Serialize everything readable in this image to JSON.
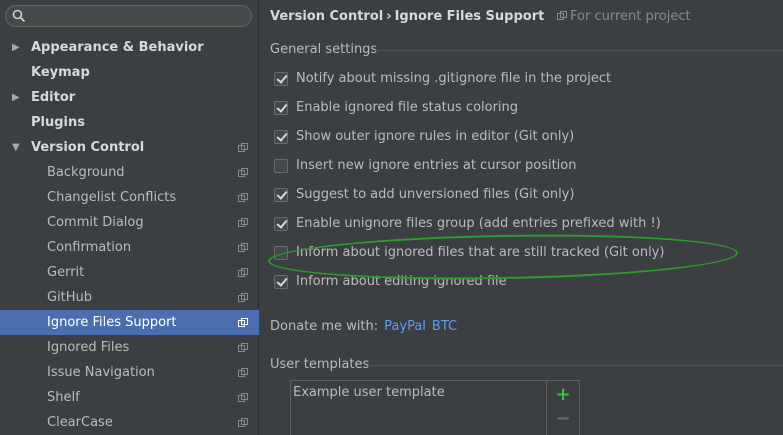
{
  "search": {
    "placeholder": ""
  },
  "sidebar": {
    "items": [
      {
        "label": "Appearance & Behavior",
        "level": 0,
        "expandable": true,
        "expanded": false
      },
      {
        "label": "Keymap",
        "level": 0,
        "expandable": false
      },
      {
        "label": "Editor",
        "level": 0,
        "expandable": true,
        "expanded": false
      },
      {
        "label": "Plugins",
        "level": 0,
        "expandable": false
      },
      {
        "label": "Version Control",
        "level": 0,
        "expandable": true,
        "expanded": true
      },
      {
        "label": "Background",
        "level": 1
      },
      {
        "label": "Changelist Conflicts",
        "level": 1
      },
      {
        "label": "Commit Dialog",
        "level": 1
      },
      {
        "label": "Confirmation",
        "level": 1
      },
      {
        "label": "Gerrit",
        "level": 1
      },
      {
        "label": "GitHub",
        "level": 1
      },
      {
        "label": "Ignore Files Support",
        "level": 1,
        "selected": true
      },
      {
        "label": "Ignored Files",
        "level": 1
      },
      {
        "label": "Issue Navigation",
        "level": 1
      },
      {
        "label": "Shelf",
        "level": 1
      },
      {
        "label": "ClearCase",
        "level": 1
      }
    ]
  },
  "header": {
    "crumb1": "Version Control",
    "separator": "›",
    "crumb2": "Ignore Files Support",
    "scope": "For current project"
  },
  "general": {
    "title": "General settings",
    "options": [
      {
        "label": "Notify about missing .gitignore file in the project",
        "checked": true
      },
      {
        "label": "Enable ignored file status coloring",
        "checked": true
      },
      {
        "label": "Show outer ignore rules in editor (Git only)",
        "checked": true
      },
      {
        "label": "Insert new ignore entries at cursor position",
        "checked": false
      },
      {
        "label": "Suggest to add unversioned files (Git only)",
        "checked": true
      },
      {
        "label": "Enable unignore files group (add entries prefixed with !)",
        "checked": true
      },
      {
        "label": "Inform about ignored files that are still tracked (Git only)",
        "checked": false
      },
      {
        "label": "Inform about editing ignored file",
        "checked": true
      }
    ]
  },
  "donate": {
    "label": "Donate me with:",
    "paypal": "PayPal",
    "btc": "BTC"
  },
  "templates": {
    "title": "User templates",
    "items": [
      "Example user template"
    ],
    "add": "+",
    "remove": "−"
  },
  "colors": {
    "background": "#3c3f41",
    "selection": "#4b6eaf",
    "link": "#589df6",
    "highlight_ellipse": "#2a9d2a",
    "add_button": "#3fbf3f"
  }
}
